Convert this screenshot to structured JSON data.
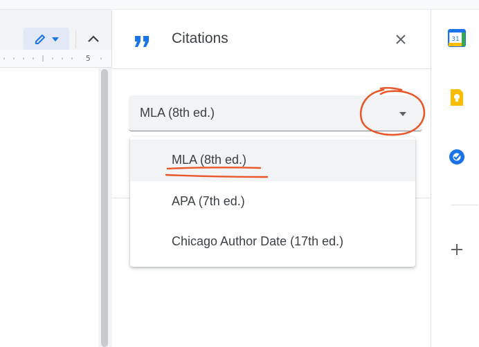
{
  "toolbar": {
    "edit_mode_icon": "pencil-icon",
    "edit_mode_dropdown_icon": "caret-down-icon",
    "collapse_icon": "chevron-up-icon"
  },
  "ruler": {
    "mark_label": "5"
  },
  "citations_panel": {
    "header_icon": "quote-icon",
    "title": "Citations",
    "close_icon": "close-icon",
    "style_select": {
      "value": "MLA (8th ed.)",
      "arrow_icon": "caret-down-icon"
    },
    "menu": {
      "options": [
        {
          "label": "MLA (8th ed.)",
          "selected": true
        },
        {
          "label": "APA (7th ed.)",
          "selected": false
        },
        {
          "label": "Chicago Author Date (17th ed.)",
          "selected": false
        }
      ]
    }
  },
  "side_panel": {
    "buttons": [
      {
        "icon": "calendar-icon",
        "day": "31"
      },
      {
        "icon": "keep-icon"
      },
      {
        "icon": "tasks-icon"
      },
      {
        "icon": "plus-icon"
      }
    ]
  },
  "colors": {
    "accent_blue": "#1a73e8",
    "annotation_orange": "#e8562a",
    "panel_text": "#3c4043",
    "select_bg": "#f1f3f4"
  }
}
